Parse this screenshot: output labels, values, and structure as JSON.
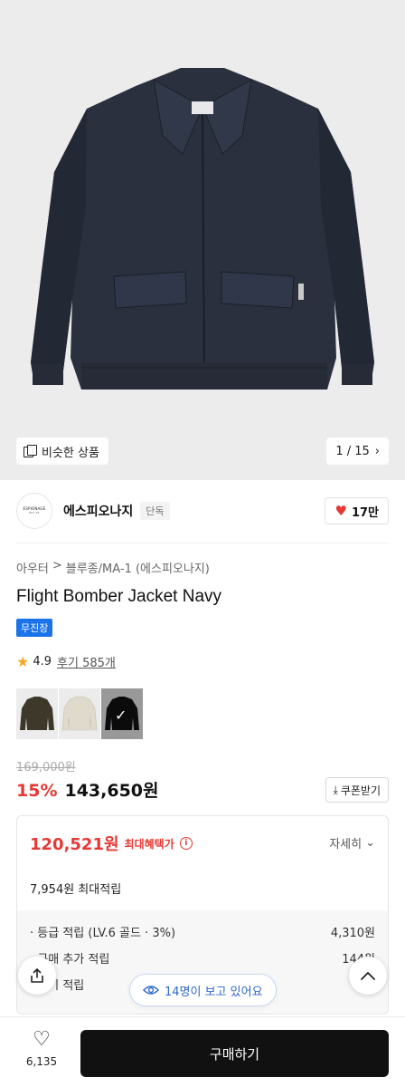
{
  "hero": {
    "similar_label": "비슷한 상품",
    "pager_text": "1 / 15",
    "pager_icon": "chevron-right-icon"
  },
  "brand": {
    "logo_line1": "ESPIONAGE",
    "logo_line2": "EST 04",
    "name": "에스피오나지",
    "tag": "단독",
    "likes": "17만"
  },
  "product": {
    "breadcrumb": [
      "아우터",
      ">",
      "블루종/MA-1 (에스피오나지)"
    ],
    "title": "Flight Bomber Jacket Navy",
    "badge": "무진장",
    "rating": "4.9",
    "reviews": "후기 585개",
    "swatches": [
      {
        "name": "olive",
        "color": "#3a3428",
        "selected": false
      },
      {
        "name": "beige",
        "color": "#e3ddd2",
        "selected": false
      },
      {
        "name": "black",
        "color": "#111111",
        "selected": true
      }
    ]
  },
  "price": {
    "original": "169,000원",
    "discount": "15%",
    "sale": "143,650원",
    "coupon_label": "쿠폰받기"
  },
  "benefit": {
    "max_price": "120,521원",
    "max_label": "최대혜택가",
    "detail_label": "자세히",
    "points": "7,954원 최대적립",
    "lines": [
      {
        "label": "· 등급 적립 (LV.6 골드 · 3%)",
        "value": "4,310원"
      },
      {
        "label": "· 구매 추가 적립",
        "value": "144원"
      },
      {
        "label": "· 후기 적립",
        "value": "3,5"
      }
    ]
  },
  "floating": {
    "viewers": "14명이 보고 있어요"
  },
  "bottom": {
    "wish_count": "6,135",
    "buy_label": "구매하기"
  },
  "colors": {
    "accent_red": "#e53935",
    "navy_jacket": "#2a303d",
    "link_blue": "#2e69c7"
  }
}
